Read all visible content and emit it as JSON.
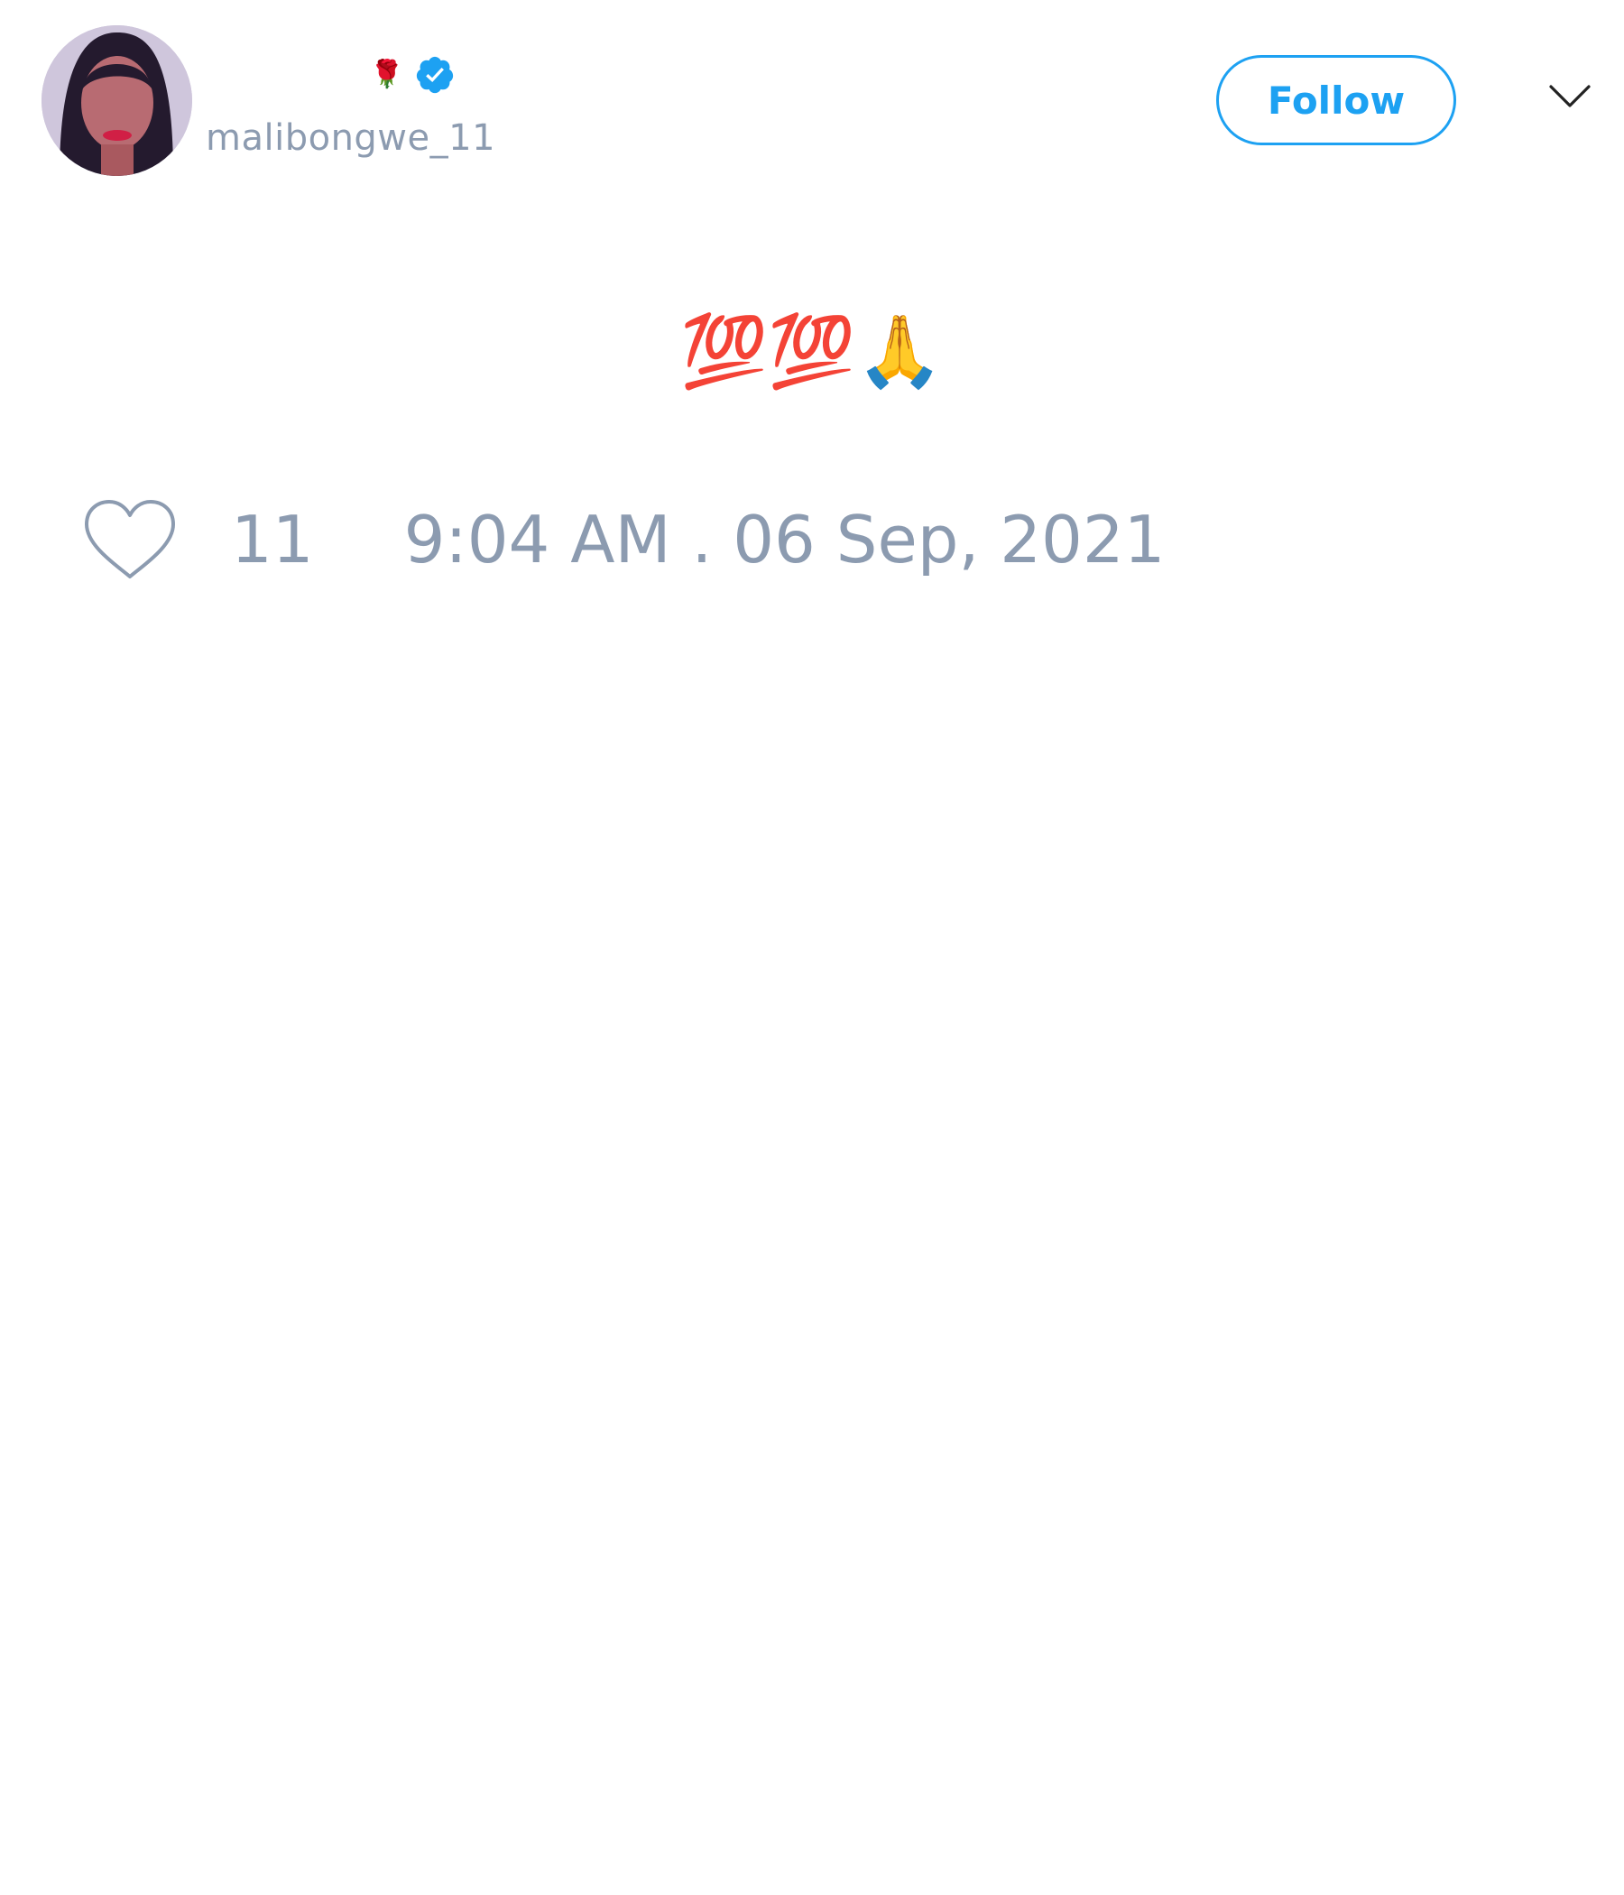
{
  "user": {
    "name_emoji": "🌹",
    "handle": "malibongwe_11",
    "verified": true
  },
  "follow_label": "Follow",
  "tweet": {
    "text": "💯💯🙏",
    "like_count": "11",
    "timestamp": "9:04 AM . 06 Sep, 2021"
  },
  "colors": {
    "accent": "#1da1f2",
    "muted_text": "#8c9bb0"
  }
}
